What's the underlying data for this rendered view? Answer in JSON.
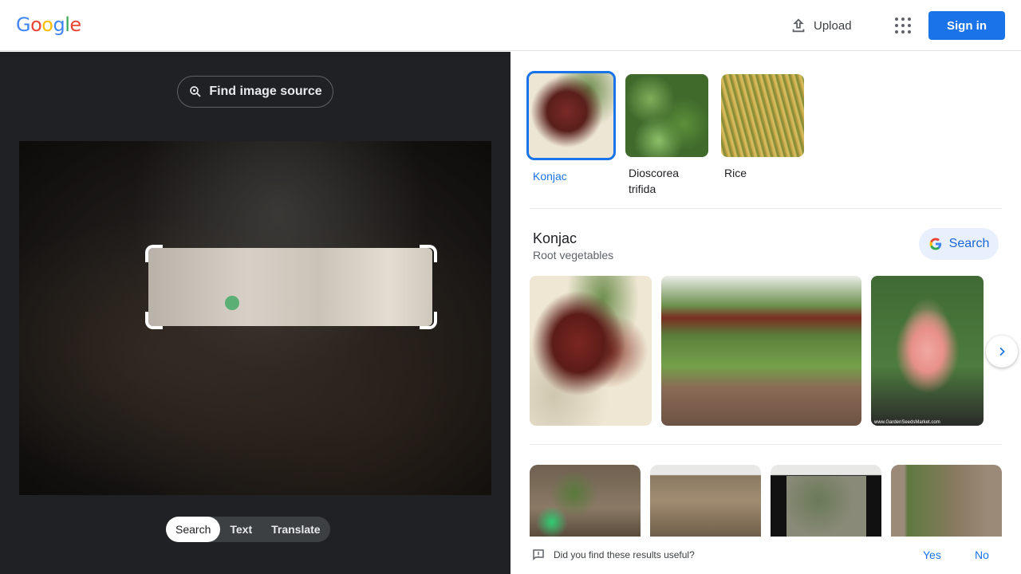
{
  "header": {
    "logo_letters": [
      "G",
      "o",
      "o",
      "g",
      "l",
      "e"
    ],
    "logo_colors": [
      "#4285F4",
      "#EA4335",
      "#FBBC05",
      "#4285F4",
      "#34A853",
      "#EA4335"
    ],
    "upload_label": "Upload",
    "upload_icon": "upload-icon",
    "apps_icon": "apps-grid-icon",
    "signin_label": "Sign in"
  },
  "left_panel": {
    "find_source_label": "Find image source",
    "find_source_icon": "lens-search-icon",
    "modes": [
      {
        "label": "Search",
        "active": true
      },
      {
        "label": "Text",
        "active": false
      },
      {
        "label": "Translate",
        "active": false
      }
    ]
  },
  "right_panel": {
    "chips": [
      {
        "label": "Konjac",
        "selected": true
      },
      {
        "label": "Dioscorea trifida",
        "selected": false
      },
      {
        "label": "Rice",
        "selected": false
      }
    ],
    "entity": {
      "title": "Konjac",
      "subtitle": "Root vegetables",
      "search_label": "Search",
      "search_icon": "google-g-icon"
    },
    "gallery_next_icon": "chevron-right-icon",
    "gallery_watermark": "www.GardenSeedsMarket.com",
    "feedback": {
      "question": "Did you find these results useful?",
      "icon": "feedback-icon",
      "yes_label": "Yes",
      "no_label": "No"
    }
  },
  "colors": {
    "accent": "#1a73e8",
    "dark_panel": "#202124"
  }
}
